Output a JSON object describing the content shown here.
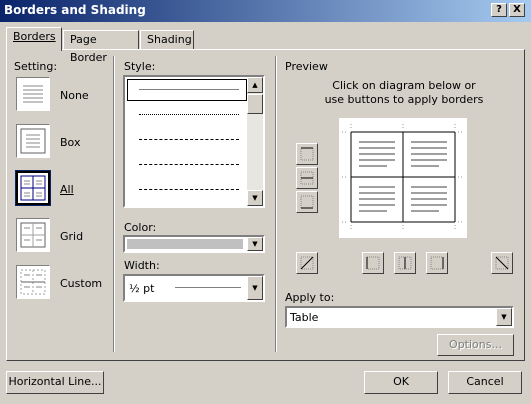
{
  "window": {
    "title": "Borders and Shading",
    "help_label": "?",
    "close_label": "X"
  },
  "tabs": [
    {
      "label": "Borders",
      "active": true
    },
    {
      "label": "Page Border",
      "active": false
    },
    {
      "label": "Shading",
      "active": false
    }
  ],
  "setting": {
    "label": "Setting:",
    "options": [
      {
        "label": "None",
        "icon": "setting-none-icon"
      },
      {
        "label": "Box",
        "icon": "setting-box-icon"
      },
      {
        "label": "All",
        "icon": "setting-all-icon",
        "selected": true
      },
      {
        "label": "Grid",
        "icon": "setting-grid-icon"
      },
      {
        "label": "Custom",
        "icon": "setting-custom-icon"
      }
    ]
  },
  "style": {
    "label": "Style:",
    "items": [
      "solid",
      "dotted",
      "dashed-small",
      "dashed-large",
      "dash-dot"
    ],
    "selected": "solid"
  },
  "color": {
    "label": "Color:",
    "value": ""
  },
  "width": {
    "label": "Width:",
    "value": "½ pt"
  },
  "preview": {
    "label": "Preview",
    "instructions": "Click on diagram below or use buttons to apply borders"
  },
  "apply_to": {
    "label": "Apply to:",
    "value": "Table"
  },
  "buttons": {
    "options": "Options...",
    "horizontal_line": "Horizontal Line...",
    "ok": "OK",
    "cancel": "Cancel"
  },
  "colors": {
    "title_start": "#0a246a",
    "title_end": "#a6caf0",
    "face": "#d4d0c8",
    "color_swatch": "#c0c0c0"
  }
}
